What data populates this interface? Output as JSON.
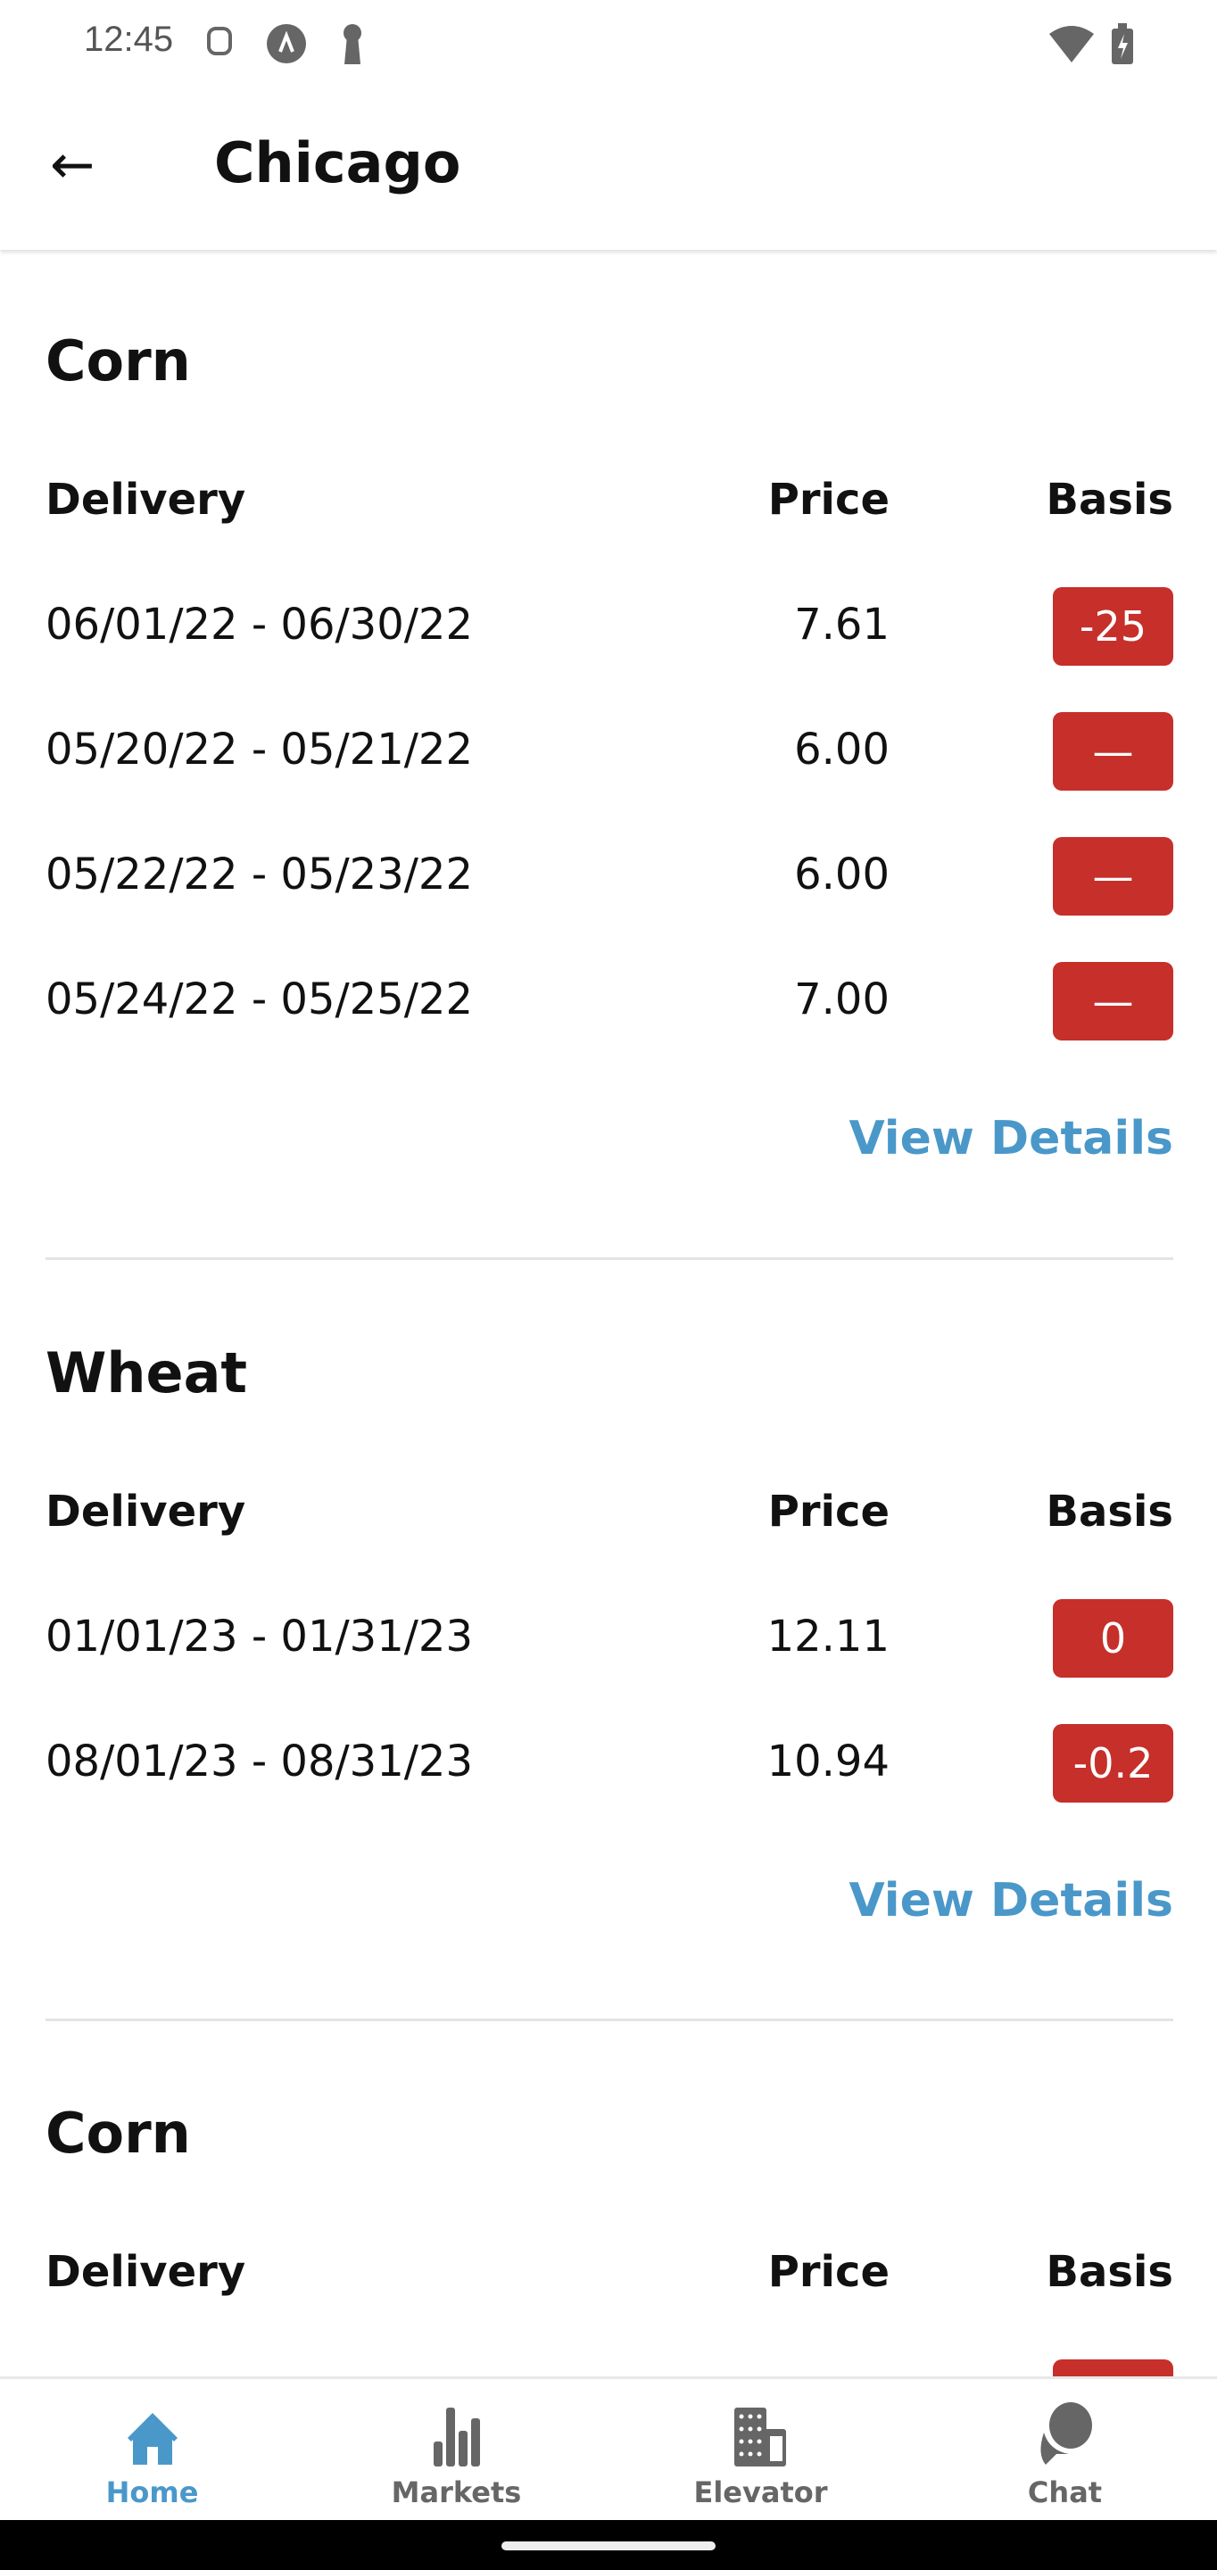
{
  "status_bar": {
    "time": "12:45"
  },
  "header": {
    "title": "Chicago"
  },
  "columns": {
    "delivery": "Delivery",
    "price": "Price",
    "basis": "Basis"
  },
  "view_details": "View Details",
  "sections": [
    {
      "title": "Corn",
      "rows": [
        {
          "delivery": "06/01/22 - 06/30/22",
          "price": "7.61",
          "basis": "-25"
        },
        {
          "delivery": "05/20/22 - 05/21/22",
          "price": "6.00",
          "basis": "—"
        },
        {
          "delivery": "05/22/22 - 05/23/22",
          "price": "6.00",
          "basis": "—"
        },
        {
          "delivery": "05/24/22 - 05/25/22",
          "price": "7.00",
          "basis": "—"
        }
      ]
    },
    {
      "title": "Wheat",
      "rows": [
        {
          "delivery": "01/01/23 - 01/31/23",
          "price": "12.11",
          "basis": "0"
        },
        {
          "delivery": "08/01/23 - 08/31/23",
          "price": "10.94",
          "basis": "-0.2"
        }
      ]
    },
    {
      "title": "Corn",
      "rows": []
    }
  ],
  "nav": [
    {
      "label": "Home",
      "icon": "home-icon",
      "active": true
    },
    {
      "label": "Markets",
      "icon": "bar-chart-icon"
    },
    {
      "label": "Elevator",
      "icon": "building-icon"
    },
    {
      "label": "Chat",
      "icon": "chat-icon"
    }
  ],
  "colors": {
    "accent": "#4a98c9",
    "basis_badge": "#c62f2a"
  }
}
